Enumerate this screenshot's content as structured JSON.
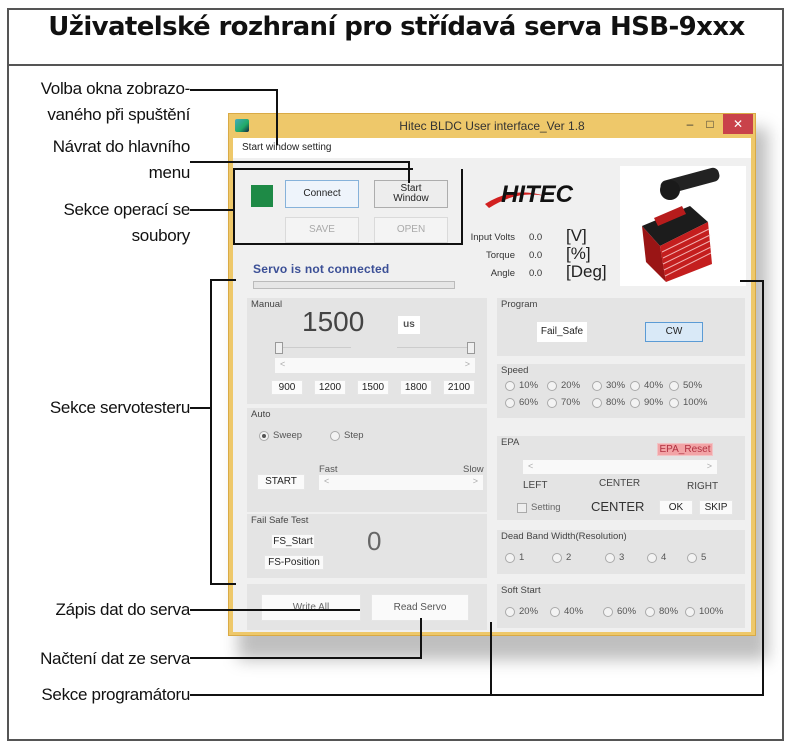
{
  "page": {
    "title": "Uživatelské rozhraní pro střídavá serva HSB-9xxx"
  },
  "annotations": {
    "start_window": "Volba okna zobrazo-\nvaného při spuštění",
    "start_window_l1": "Volba okna zobrazo-",
    "start_window_l2": "vaného při spuštění",
    "return_main_l1": "Návrat do hlavního",
    "return_main_l2": "menu",
    "file_ops_l1": "Sekce operací se",
    "file_ops_l2": "soubory",
    "servotester": "Sekce servotesteru",
    "write_data": "Zápis dat do serva",
    "read_data": "Načtení dat ze serva",
    "programmer": "Sekce programátoru"
  },
  "window": {
    "title": "Hitec BLDC User interface_Ver 1.8",
    "minimize": "–",
    "maximize": "□",
    "close": "✕",
    "menu": "Start window setting"
  },
  "top": {
    "status_color": "#1e8a46",
    "connect": "Connect",
    "start_window_l1": "Start",
    "start_window_l2": "Window",
    "save": "SAVE",
    "open": "OPEN",
    "status_text": "Servo is not connected",
    "logo": "HITEC",
    "readouts": [
      {
        "label": "Input Volts",
        "value": "0.0",
        "unit": "[V]"
      },
      {
        "label": "Torque",
        "value": "0.0",
        "unit": "[%]"
      },
      {
        "label": "Angle",
        "value": "0.0",
        "unit": "[Deg]"
      }
    ]
  },
  "manual": {
    "label": "Manual",
    "value": "1500",
    "unit": "us",
    "presets": [
      "900",
      "1200",
      "1500",
      "1800",
      "2100"
    ]
  },
  "auto": {
    "label": "Auto",
    "modes": [
      {
        "label": "Sweep",
        "selected": true
      },
      {
        "label": "Step",
        "selected": false
      }
    ],
    "start": "START",
    "fast": "Fast",
    "slow": "Slow"
  },
  "failsafe": {
    "label": "Fail Safe Test",
    "start": "FS_Start",
    "position": "FS-Position",
    "value": "0"
  },
  "bottom": {
    "write_all": "Write All",
    "read_servo": "Read Servo"
  },
  "program": {
    "label": "Program",
    "fail_safe": "Fail_Safe",
    "direction": "CW"
  },
  "speed": {
    "label": "Speed",
    "options": [
      "10%",
      "20%",
      "30%",
      "40%",
      "50%",
      "60%",
      "70%",
      "80%",
      "90%",
      "100%"
    ]
  },
  "epa": {
    "label": "EPA",
    "reset": "EPA_Reset",
    "left": "LEFT",
    "center": "CENTER",
    "right": "RIGHT",
    "setting": "Setting",
    "current": "CENTER",
    "ok": "OK",
    "skip": "SKIP"
  },
  "deadband": {
    "label": "Dead Band Width(Resolution)",
    "options": [
      "1",
      "2",
      "3",
      "4",
      "5"
    ]
  },
  "softstart": {
    "label": "Soft Start",
    "options": [
      "20%",
      "40%",
      "60%",
      "80%",
      "100%"
    ]
  }
}
